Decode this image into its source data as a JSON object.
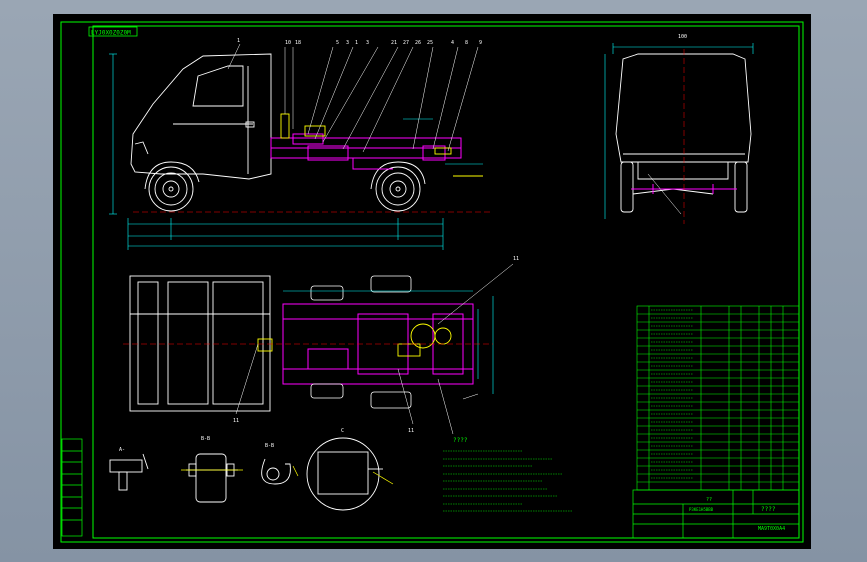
{
  "drawing": {
    "drawing_number": "LYJ0X0Z0Z0M",
    "callouts_top": [
      "1",
      "10",
      "18",
      "5",
      "3",
      "1",
      "3",
      "21",
      "27",
      "26",
      "25",
      "4",
      "8",
      "9"
    ],
    "dim_side_top": "1",
    "dim_front": "100",
    "sections": [
      {
        "label": "A-",
        "sub": "A"
      },
      {
        "label": "B-B",
        "sub": "B"
      },
      {
        "label": "B-B",
        "sub": "B"
      },
      {
        "label": "C",
        "sub": "C"
      }
    ],
    "notes_heading": "????",
    "title_block": {
      "title": "????",
      "code": "??",
      "unit": "MA9T0X0A4",
      "drawn": "P3KE1H5BBB"
    },
    "bom_rows": 17
  },
  "colors": {
    "border": "#00ff00",
    "frame": "#ff00ff",
    "body": "#ffffff",
    "dim": "#00ffff",
    "center": "#ff0000",
    "accent": "#ffff00"
  }
}
